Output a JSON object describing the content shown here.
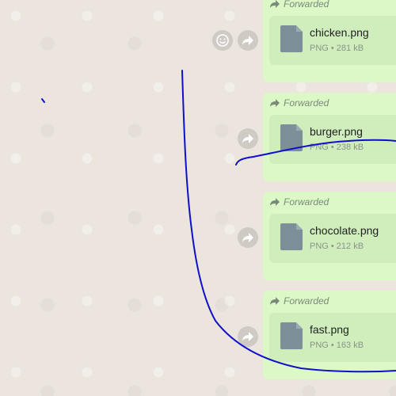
{
  "chat": {
    "messages": [
      {
        "forwarded_label": "Forwarded",
        "filename": "chicken.png",
        "meta": "PNG • 281 kB"
      },
      {
        "forwarded_label": "Forwarded",
        "filename": "burger.png",
        "meta": "PNG • 238 kB"
      },
      {
        "forwarded_label": "Forwarded",
        "filename": "chocolate.png",
        "meta": "PNG • 212 kB"
      },
      {
        "forwarded_label": "Forwarded",
        "filename": "fast.png",
        "meta": "PNG • 163 kB"
      }
    ]
  },
  "icons": {
    "forward": "forward-arrow-icon",
    "emoji": "emoji-icon",
    "document": "document-icon"
  },
  "colors": {
    "bubble": "#dcf8c6",
    "file_card": "#cfeebc",
    "ink": "#1010cc"
  }
}
